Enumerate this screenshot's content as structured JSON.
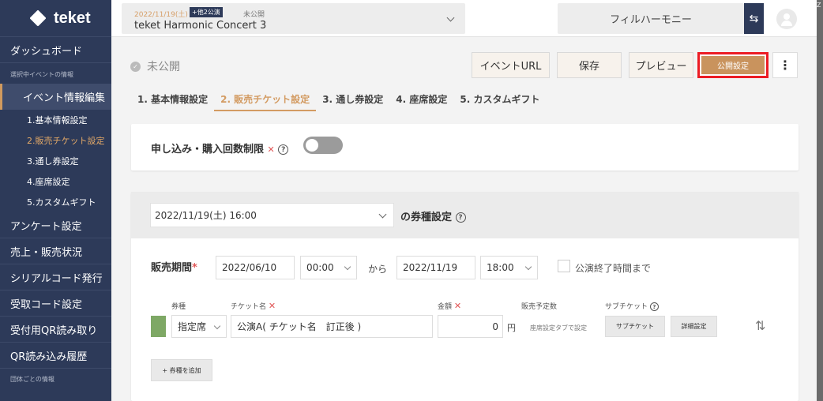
{
  "sidebar": {
    "logo_text": "teket",
    "items": [
      {
        "label": "ダッシュボード"
      },
      {
        "label": "アンケート設定"
      },
      {
        "label": "売上・販売状況"
      },
      {
        "label": "シリアルコード発行"
      },
      {
        "label": "受取コード設定"
      },
      {
        "label": "受付用QR読み取り"
      },
      {
        "label": "QR読み込み履歴"
      }
    ],
    "section_event": "選択中イベントの情報",
    "active_item": "イベント情報編集",
    "sub_items": [
      {
        "label": "1.基本情報設定"
      },
      {
        "label": "2.販売チケット設定"
      },
      {
        "label": "3.通し券設定"
      },
      {
        "label": "4.座席設定"
      },
      {
        "label": "5.カスタムギフト"
      }
    ],
    "section_group": "団体ごとの情報"
  },
  "header": {
    "event_date": "2022/11/19(土)",
    "event_badge": "+他2公演",
    "event_status": "未公開",
    "event_name": "teket Harmonic Concert 3",
    "org_name": "フィルハーモニー",
    "switch_icon": "swap-icon",
    "edge_text": "Ζ"
  },
  "toolbar": {
    "status": "未公開",
    "event_url": "イベントURL",
    "save": "保存",
    "preview": "プレビュー",
    "publish_settings": "公開設定",
    "more": "⋮",
    "highlight_color": "#ec1c24",
    "accent_color": "#c9935d"
  },
  "tabs": [
    {
      "label": "1. 基本情報設定",
      "active": false
    },
    {
      "label": "2. 販売チケット設定",
      "active": true
    },
    {
      "label": "3. 通し券設定",
      "active": false
    },
    {
      "label": "4. 座席設定",
      "active": false
    },
    {
      "label": "5. カスタムギフト",
      "active": false
    }
  ],
  "limit": {
    "label": "申し込み・購入回数制限",
    "enabled": false
  },
  "ticket": {
    "performance": "2022/11/19(土) 16:00",
    "type_settings_label": "の券種設定",
    "sales_period_label": "販売期間",
    "required_mark": "*",
    "start_date": "2022/06/10",
    "start_time": "00:00",
    "from_label": "から",
    "end_date": "2022/11/19",
    "end_time": "18:00",
    "until_end_label": "公演終了時間まで",
    "col_type": "券種",
    "col_name": "チケット名",
    "col_price": "金額",
    "col_quantity": "販売予定数",
    "col_subticket": "サブチケット",
    "row": {
      "color": "#7ea865",
      "type": "指定席",
      "name": "公演A( チケット名　訂正後 )",
      "price": "0",
      "currency": "円",
      "quantity_note": "座席設定タブで設定",
      "subticket_button": "サブチケット",
      "detail_button": "詳細設定"
    },
    "add_type_button": "+ 券種を追加"
  }
}
